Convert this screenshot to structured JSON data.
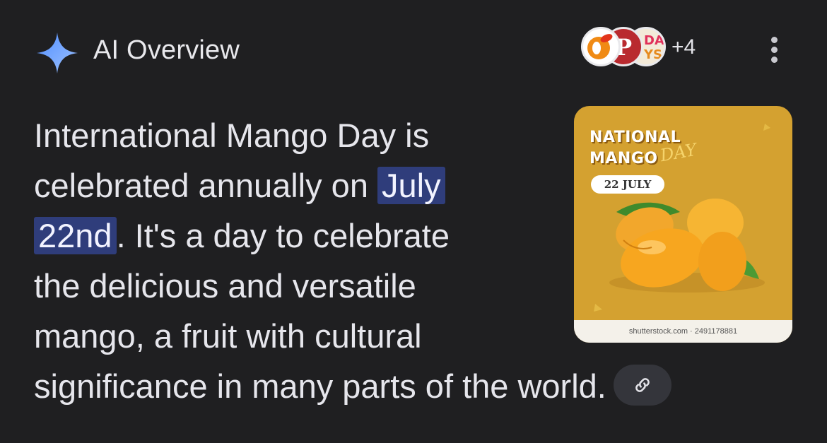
{
  "header": {
    "title": "AI Overview",
    "sparkle_icon": "gemini-sparkle-icon",
    "sources": [
      {
        "name": "source-1",
        "glyph": ""
      },
      {
        "name": "source-2",
        "glyph": "P"
      },
      {
        "name": "source-3",
        "glyph": "DA YS"
      }
    ],
    "more_sources": "+4",
    "menu_icon": "more-vert-icon"
  },
  "answer": {
    "line1": "International Mango Day is",
    "line2_pre": "celebrated annually on ",
    "line2_hl": "July",
    "line3_hl": "22nd",
    "line3_post": ". It's a day to celebrate",
    "line4": "the delicious and versatile",
    "line5": "mango, a fruit with cultural",
    "line6": "significance in many parts of the world.",
    "link_icon": "link-icon"
  },
  "image": {
    "heading_1": "NATIONAL",
    "heading_2": "MANGO",
    "heading_script": "DAY",
    "date": "22 JULY",
    "credit": "shutterstock.com · 2491178881"
  },
  "colors": {
    "background": "#1f1f21",
    "highlight": "#2f3d7b",
    "image_bg": "#d4a130"
  }
}
